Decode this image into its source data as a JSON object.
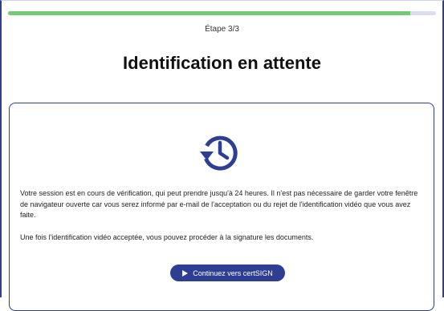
{
  "progress": {
    "value": 0.94
  },
  "step": {
    "label": "Étape 3/3"
  },
  "title": "Identification en attente",
  "icon": {
    "name": "history-icon",
    "color": "#2e3f93"
  },
  "messages": {
    "verification": "Votre session est en cours de vérification, qui peut prendre jusqu'à 24 heures. Il n'est pas nécessaire de garder votre fenêtre de navigateur ouverte car vous serez informé par e-mail de l'acceptation ou du rejet de l'identification vidéo que vous avez faite.",
    "next_step": "Une fois l'identification vidéo acceptée, vous pouvez procéder à la signature les documents."
  },
  "cta": {
    "label": "Continuez vers certSIGN",
    "icon": "play-icon"
  },
  "colors": {
    "accent": "#2e3f93",
    "progress_fill": "#76c776",
    "progress_track": "#dcdcf0"
  }
}
